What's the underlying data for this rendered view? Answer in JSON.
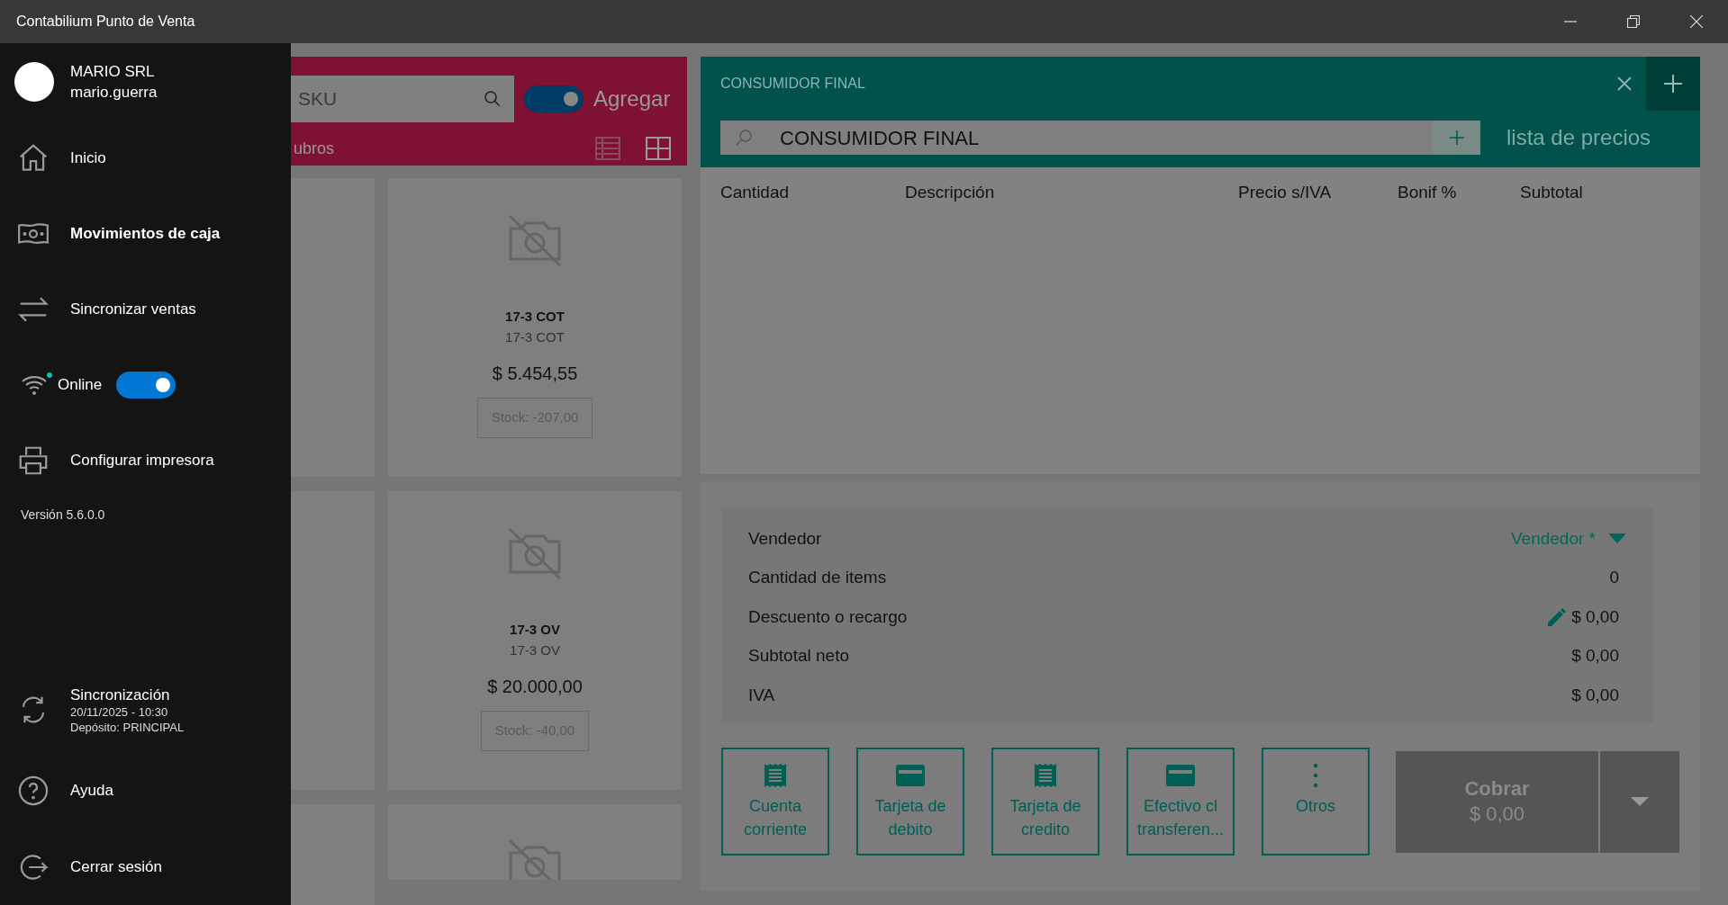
{
  "window": {
    "title": "Contabilium Punto de Venta"
  },
  "sidebar": {
    "user": {
      "company": "MARIO SRL",
      "username": "mario.guerra"
    },
    "items": [
      {
        "kind": "home",
        "label": "Inicio",
        "bold": false
      },
      {
        "kind": "cash",
        "label": "Movimientos de caja",
        "bold": true
      },
      {
        "kind": "sync-arrows",
        "label": "Sincronizar ventas",
        "bold": false
      },
      {
        "kind": "online",
        "label": "Online",
        "on": true
      },
      {
        "kind": "printer",
        "label": "Configurar impresora",
        "bold": false
      }
    ],
    "version": "Versión 5.6.0.0",
    "sync": {
      "title": "Sincronización",
      "datetime": "20/11/2025 - 10:30",
      "deposit": "Depósito: PRINCIPAL"
    },
    "bottom_items": [
      {
        "kind": "help",
        "label": "Ayuda"
      },
      {
        "kind": "logout",
        "label": "Cerrar sesión"
      }
    ]
  },
  "products": {
    "search": {
      "placeholder": "SKU"
    },
    "add_toggle": {
      "on": true,
      "label": "Agregar"
    },
    "category_filter": "ubros",
    "views": [
      {
        "kind": "list",
        "selected": false
      },
      {
        "kind": "grid",
        "selected": true
      }
    ],
    "cards": [
      {
        "kind": "cut"
      },
      {
        "kind": "full",
        "name": "17-3 COT",
        "code": "17-3 COT",
        "price": "$ 5.454,55",
        "stock": "Stock: -207,00"
      },
      {
        "kind": "cut"
      },
      {
        "kind": "full",
        "name": "17-3 OV",
        "code": "17-3 OV",
        "price": "$ 20.000,00",
        "stock": "Stock: -40,00"
      },
      {
        "kind": "cut"
      },
      {
        "kind": "image"
      }
    ]
  },
  "sale": {
    "customer_title": "CONSUMIDOR FINAL",
    "customer_search": {
      "value": "CONSUMIDOR FINAL"
    },
    "price_list": "lista de precios",
    "columns": [
      "Cantidad",
      "Descripción",
      "Precio s/IVA",
      "Bonif %",
      "Subtotal"
    ],
    "summary": [
      {
        "kind": "select",
        "label": "Vendedor",
        "value": "Vendedor *"
      },
      {
        "kind": "plain",
        "label": "Cantidad de items",
        "value": "0"
      },
      {
        "kind": "edit",
        "label": "Descuento o recargo",
        "value": "$ 0,00"
      },
      {
        "kind": "plain",
        "label": "Subtotal neto",
        "value": "$ 0,00"
      },
      {
        "kind": "plain",
        "label": "IVA",
        "value": "$ 0,00"
      }
    ],
    "payment_buttons": [
      {
        "kind": "receipt",
        "label": "Cuenta corriente"
      },
      {
        "kind": "card",
        "label": "Tarjeta de debito"
      },
      {
        "kind": "receipt",
        "label": "Tarjeta de credito"
      },
      {
        "kind": "card",
        "label": "Efectivo cl transferen..."
      },
      {
        "kind": "dots",
        "label": "Otros"
      }
    ],
    "charge": {
      "label": "Cobrar",
      "amount": "$ 0,00",
      "disabled": true
    }
  }
}
